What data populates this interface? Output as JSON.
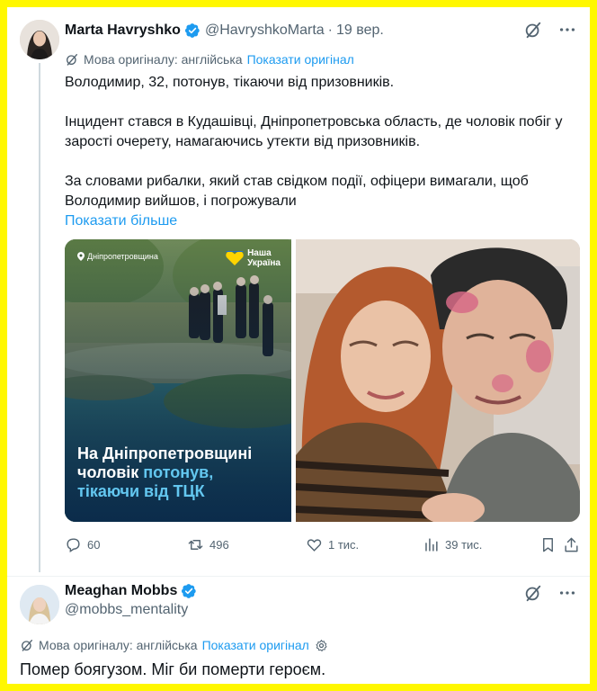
{
  "tweet1": {
    "author_name": "Marta Havryshko",
    "handle": "@HavryshkoMarta",
    "separator": "·",
    "time": "19 вер.",
    "translation_note": "Мова оригіналу: англійська",
    "show_original": "Показати оригінал",
    "paragraphs": [
      "Володимир, 32, потонув, тікаючи від призовників.",
      "Інцидент стався в Кудашівці, Дніпропетровська область, де чоловік побіг у зарості очерету, намагаючись утекти від призовників.",
      "За словами рибалки, який став свідком події, офіцери вимагали, щоб Володимир вийшов, і погрожували"
    ],
    "show_more": "Показати більше",
    "media_left": {
      "location": "Дніпропетровщина",
      "brand_line1": "Наша",
      "brand_line2": "Україна",
      "caption_line1": "На Дніпропетровщині",
      "caption_line2_prefix": "чоловік ",
      "caption_line2_accent": "потонув,",
      "caption_line3": "тікаючи від ТЦК"
    },
    "stats": {
      "replies": "60",
      "reposts": "496",
      "likes": "1 тис.",
      "views": "39 тис."
    }
  },
  "tweet2": {
    "author_name": "Meaghan Mobbs",
    "handle": "@mobbs_mentality",
    "translation_note": "Мова оригіналу: англійська",
    "show_original": "Показати оригінал",
    "text": "Помер боягузом. Міг би померти героєм."
  },
  "colors": {
    "frame_border": "#fff700",
    "accent_blue": "#1d9bf0",
    "muted_text": "#536471",
    "caption_accent": "#63c7f0"
  }
}
